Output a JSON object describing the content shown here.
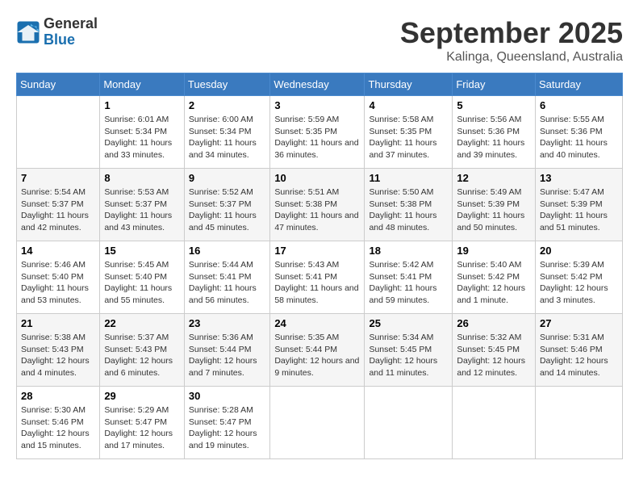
{
  "header": {
    "logo": {
      "general": "General",
      "blue": "Blue"
    },
    "title": "September 2025",
    "location": "Kalinga, Queensland, Australia"
  },
  "weekdays": [
    "Sunday",
    "Monday",
    "Tuesday",
    "Wednesday",
    "Thursday",
    "Friday",
    "Saturday"
  ],
  "weeks": [
    [
      null,
      {
        "day": 1,
        "sunrise": "6:01 AM",
        "sunset": "5:34 PM",
        "daylight": "11 hours and 33 minutes."
      },
      {
        "day": 2,
        "sunrise": "6:00 AM",
        "sunset": "5:34 PM",
        "daylight": "11 hours and 34 minutes."
      },
      {
        "day": 3,
        "sunrise": "5:59 AM",
        "sunset": "5:35 PM",
        "daylight": "11 hours and 36 minutes."
      },
      {
        "day": 4,
        "sunrise": "5:58 AM",
        "sunset": "5:35 PM",
        "daylight": "11 hours and 37 minutes."
      },
      {
        "day": 5,
        "sunrise": "5:56 AM",
        "sunset": "5:36 PM",
        "daylight": "11 hours and 39 minutes."
      },
      {
        "day": 6,
        "sunrise": "5:55 AM",
        "sunset": "5:36 PM",
        "daylight": "11 hours and 40 minutes."
      }
    ],
    [
      {
        "day": 7,
        "sunrise": "5:54 AM",
        "sunset": "5:37 PM",
        "daylight": "11 hours and 42 minutes."
      },
      {
        "day": 8,
        "sunrise": "5:53 AM",
        "sunset": "5:37 PM",
        "daylight": "11 hours and 43 minutes."
      },
      {
        "day": 9,
        "sunrise": "5:52 AM",
        "sunset": "5:37 PM",
        "daylight": "11 hours and 45 minutes."
      },
      {
        "day": 10,
        "sunrise": "5:51 AM",
        "sunset": "5:38 PM",
        "daylight": "11 hours and 47 minutes."
      },
      {
        "day": 11,
        "sunrise": "5:50 AM",
        "sunset": "5:38 PM",
        "daylight": "11 hours and 48 minutes."
      },
      {
        "day": 12,
        "sunrise": "5:49 AM",
        "sunset": "5:39 PM",
        "daylight": "11 hours and 50 minutes."
      },
      {
        "day": 13,
        "sunrise": "5:47 AM",
        "sunset": "5:39 PM",
        "daylight": "11 hours and 51 minutes."
      }
    ],
    [
      {
        "day": 14,
        "sunrise": "5:46 AM",
        "sunset": "5:40 PM",
        "daylight": "11 hours and 53 minutes."
      },
      {
        "day": 15,
        "sunrise": "5:45 AM",
        "sunset": "5:40 PM",
        "daylight": "11 hours and 55 minutes."
      },
      {
        "day": 16,
        "sunrise": "5:44 AM",
        "sunset": "5:41 PM",
        "daylight": "11 hours and 56 minutes."
      },
      {
        "day": 17,
        "sunrise": "5:43 AM",
        "sunset": "5:41 PM",
        "daylight": "11 hours and 58 minutes."
      },
      {
        "day": 18,
        "sunrise": "5:42 AM",
        "sunset": "5:41 PM",
        "daylight": "11 hours and 59 minutes."
      },
      {
        "day": 19,
        "sunrise": "5:40 AM",
        "sunset": "5:42 PM",
        "daylight": "12 hours and 1 minute."
      },
      {
        "day": 20,
        "sunrise": "5:39 AM",
        "sunset": "5:42 PM",
        "daylight": "12 hours and 3 minutes."
      }
    ],
    [
      {
        "day": 21,
        "sunrise": "5:38 AM",
        "sunset": "5:43 PM",
        "daylight": "12 hours and 4 minutes."
      },
      {
        "day": 22,
        "sunrise": "5:37 AM",
        "sunset": "5:43 PM",
        "daylight": "12 hours and 6 minutes."
      },
      {
        "day": 23,
        "sunrise": "5:36 AM",
        "sunset": "5:44 PM",
        "daylight": "12 hours and 7 minutes."
      },
      {
        "day": 24,
        "sunrise": "5:35 AM",
        "sunset": "5:44 PM",
        "daylight": "12 hours and 9 minutes."
      },
      {
        "day": 25,
        "sunrise": "5:34 AM",
        "sunset": "5:45 PM",
        "daylight": "12 hours and 11 minutes."
      },
      {
        "day": 26,
        "sunrise": "5:32 AM",
        "sunset": "5:45 PM",
        "daylight": "12 hours and 12 minutes."
      },
      {
        "day": 27,
        "sunrise": "5:31 AM",
        "sunset": "5:46 PM",
        "daylight": "12 hours and 14 minutes."
      }
    ],
    [
      {
        "day": 28,
        "sunrise": "5:30 AM",
        "sunset": "5:46 PM",
        "daylight": "12 hours and 15 minutes."
      },
      {
        "day": 29,
        "sunrise": "5:29 AM",
        "sunset": "5:47 PM",
        "daylight": "12 hours and 17 minutes."
      },
      {
        "day": 30,
        "sunrise": "5:28 AM",
        "sunset": "5:47 PM",
        "daylight": "12 hours and 19 minutes."
      },
      null,
      null,
      null,
      null
    ]
  ],
  "labels": {
    "sunrise_prefix": "Sunrise: ",
    "sunset_prefix": "Sunset: ",
    "daylight_prefix": "Daylight: "
  }
}
